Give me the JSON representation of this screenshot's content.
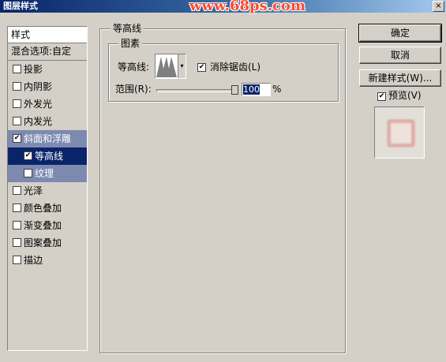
{
  "window": {
    "title": "图层样式",
    "watermark": "www.68ps.com",
    "close_glyph": "×"
  },
  "sidebar": {
    "header": "样式",
    "blend_options": "混合选项:自定",
    "items": [
      {
        "label": "投影",
        "checked": false
      },
      {
        "label": "内阴影",
        "checked": false
      },
      {
        "label": "外发光",
        "checked": false
      },
      {
        "label": "内发光",
        "checked": false
      },
      {
        "label": "斜面和浮雕",
        "checked": true
      },
      {
        "label": "等高线",
        "checked": true
      },
      {
        "label": "纹理",
        "checked": false
      },
      {
        "label": "光泽",
        "checked": false
      },
      {
        "label": "颜色叠加",
        "checked": false
      },
      {
        "label": "渐变叠加",
        "checked": false
      },
      {
        "label": "图案叠加",
        "checked": false
      },
      {
        "label": "描边",
        "checked": false
      }
    ]
  },
  "panel": {
    "group_title": "等高线",
    "subgroup_title": "图素",
    "contour_label": "等高线:",
    "antialias_label": "消除锯齿(L)",
    "antialias_checked": true,
    "range_label": "范围(R):",
    "range_value": "100",
    "range_unit": "%",
    "range_fraction": 1.0
  },
  "buttons": {
    "ok": "确定",
    "cancel": "取消",
    "new_style": "新建样式(W)...",
    "preview_label": "预览(V)",
    "preview_checked": true
  },
  "colors": {
    "selection": "#0a246a",
    "selection_parent": "#7d8ab0",
    "watermark": "#ff4a2a"
  },
  "icons": {
    "check": "✔",
    "dropdown": "▾"
  }
}
